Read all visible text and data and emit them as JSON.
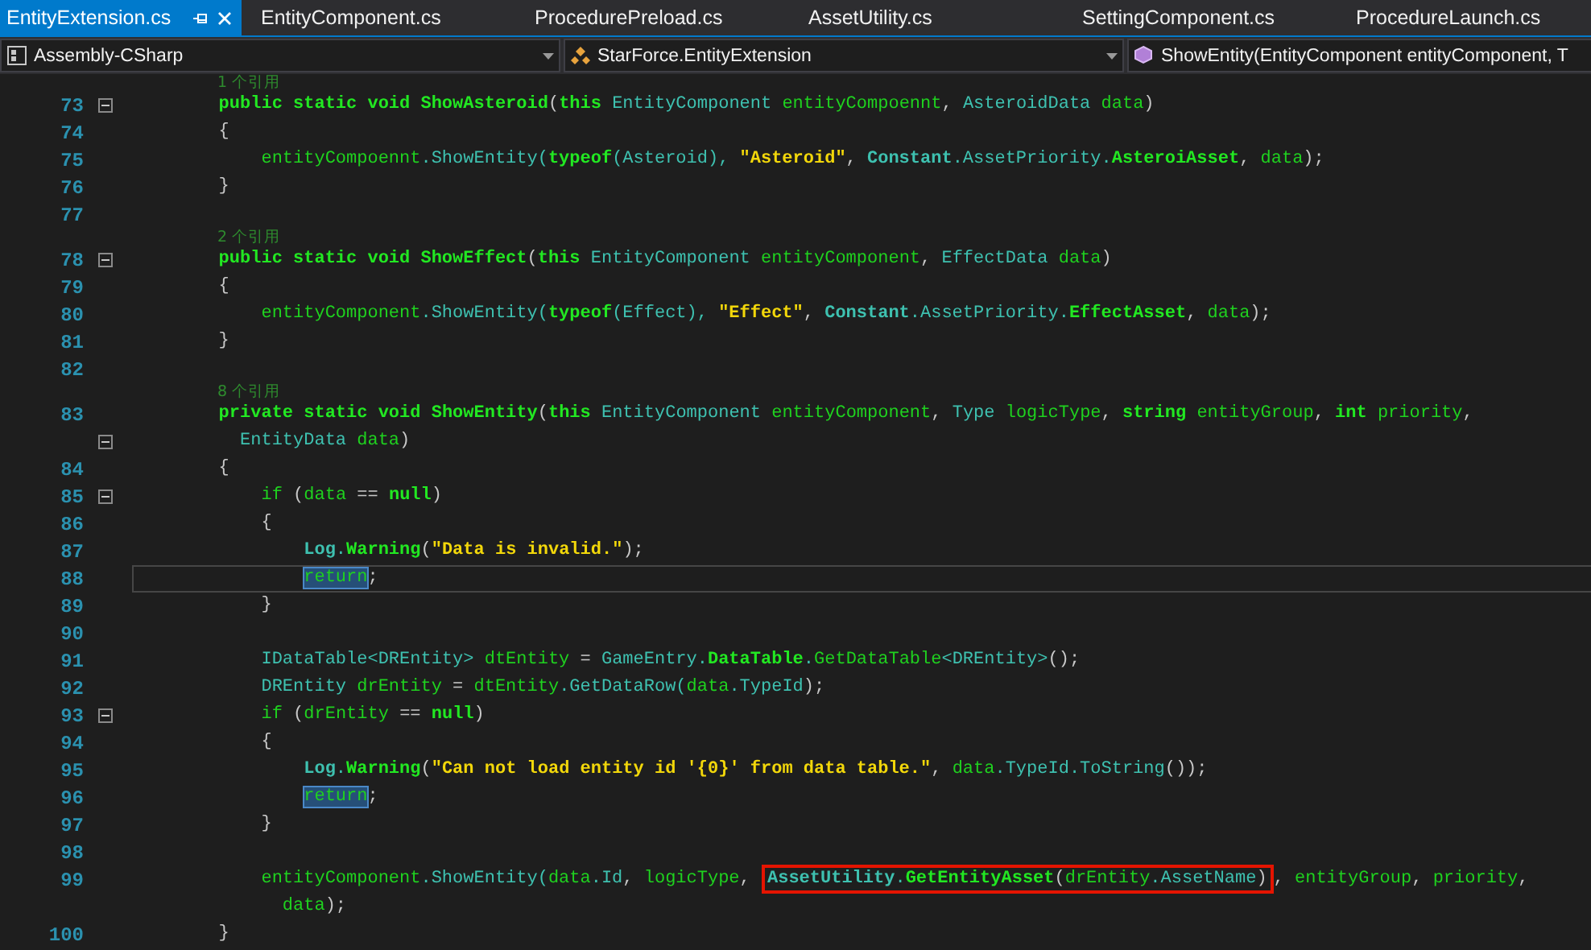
{
  "tabs": [
    {
      "label": "EntityExtension.cs",
      "selected": true
    },
    {
      "label": "EntityComponent.cs",
      "selected": false
    },
    {
      "label": "ProcedurePreload.cs",
      "selected": false
    },
    {
      "label": "AssetUtility.cs",
      "selected": false
    },
    {
      "label": "SettingComponent.cs",
      "selected": false
    },
    {
      "label": "ProcedureLaunch.cs",
      "selected": false
    }
  ],
  "navigation_bar": [
    {
      "kind": "project",
      "text": "Assembly-CSharp"
    },
    {
      "kind": "class",
      "text": "StarForce.EntityExtension"
    },
    {
      "kind": "member",
      "text": "ShowEntity(EntityComponent entityComponent, T"
    }
  ],
  "lines": [
    {
      "references": "1 个引用",
      "number": "73",
      "fold": true,
      "tokens": [
        {
          "kind": "keyword",
          "text": "        public static void "
        },
        {
          "kind": "method",
          "text": "ShowAsteroid"
        },
        {
          "kind": "punct",
          "text": "("
        },
        {
          "kind": "keyword",
          "text": "this "
        },
        {
          "kind": "type",
          "text": "EntityComponent "
        },
        {
          "kind": "name",
          "text": "entityCompoennt"
        },
        {
          "kind": "punct",
          "text": ", "
        },
        {
          "kind": "type",
          "text": "AsteroidData "
        },
        {
          "kind": "name",
          "text": "data"
        },
        {
          "kind": "punct",
          "text": ")"
        }
      ]
    },
    {
      "number": "74",
      "tokens": [
        {
          "kind": "punct",
          "text": "        {"
        }
      ]
    },
    {
      "number": "75",
      "tokens": [
        {
          "kind": "name",
          "text": "            entityCompoennt"
        },
        {
          "kind": "type",
          "text": ".ShowEntity("
        },
        {
          "kind": "keyword",
          "text": "typeof"
        },
        {
          "kind": "type",
          "text": "(Asteroid), "
        },
        {
          "kind": "string",
          "text": "\"Asteroid\""
        },
        {
          "kind": "punct",
          "text": ", "
        },
        {
          "kind": "typebold",
          "text": "Constant"
        },
        {
          "kind": "type",
          "text": ".AssetPriority."
        },
        {
          "kind": "method",
          "text": "AsteroiAsset"
        },
        {
          "kind": "punct",
          "text": ", "
        },
        {
          "kind": "name",
          "text": "data"
        },
        {
          "kind": "punct",
          "text": ");"
        }
      ]
    },
    {
      "number": "76",
      "tokens": [
        {
          "kind": "punct",
          "text": "        }"
        }
      ]
    },
    {
      "number": "77"
    },
    {
      "references": "2 个引用",
      "number": "78",
      "fold": true,
      "tokens": [
        {
          "kind": "keyword",
          "text": "        public static void "
        },
        {
          "kind": "method",
          "text": "ShowEffect"
        },
        {
          "kind": "punct",
          "text": "("
        },
        {
          "kind": "keyword",
          "text": "this "
        },
        {
          "kind": "type",
          "text": "EntityComponent "
        },
        {
          "kind": "name",
          "text": "entityComponent"
        },
        {
          "kind": "punct",
          "text": ", "
        },
        {
          "kind": "type",
          "text": "EffectData "
        },
        {
          "kind": "name",
          "text": "data"
        },
        {
          "kind": "punct",
          "text": ")"
        }
      ]
    },
    {
      "number": "79",
      "tokens": [
        {
          "kind": "punct",
          "text": "        {"
        }
      ]
    },
    {
      "number": "80",
      "tokens": [
        {
          "kind": "name",
          "text": "            entityComponent"
        },
        {
          "kind": "type",
          "text": ".ShowEntity("
        },
        {
          "kind": "keyword",
          "text": "typeof"
        },
        {
          "kind": "type",
          "text": "(Effect), "
        },
        {
          "kind": "string",
          "text": "\"Effect\""
        },
        {
          "kind": "punct",
          "text": ", "
        },
        {
          "kind": "typebold",
          "text": "Constant"
        },
        {
          "kind": "type",
          "text": ".AssetPriority."
        },
        {
          "kind": "method",
          "text": "EffectAsset"
        },
        {
          "kind": "punct",
          "text": ", "
        },
        {
          "kind": "name",
          "text": "data"
        },
        {
          "kind": "punct",
          "text": ");"
        }
      ]
    },
    {
      "number": "81",
      "tokens": [
        {
          "kind": "punct",
          "text": "        }"
        }
      ]
    },
    {
      "number": "82"
    },
    {
      "references": "8 个引用",
      "number": "83",
      "tokens": [
        {
          "kind": "keyword",
          "text": "        private static void "
        },
        {
          "kind": "method",
          "text": "ShowEntity"
        },
        {
          "kind": "punct",
          "text": "("
        },
        {
          "kind": "keyword",
          "text": "this "
        },
        {
          "kind": "type",
          "text": "EntityComponent "
        },
        {
          "kind": "name",
          "text": "entityComponent"
        },
        {
          "kind": "punct",
          "text": ", "
        },
        {
          "kind": "type",
          "text": "Type "
        },
        {
          "kind": "name",
          "text": "logicType"
        },
        {
          "kind": "punct",
          "text": ", "
        },
        {
          "kind": "keyword",
          "text": "string "
        },
        {
          "kind": "name",
          "text": "entityGroup"
        },
        {
          "kind": "punct",
          "text": ", "
        },
        {
          "kind": "keyword",
          "text": "int "
        },
        {
          "kind": "name",
          "text": "priority"
        },
        {
          "kind": "punct",
          "text": ","
        }
      ]
    },
    {
      "fold": true,
      "tokens": [
        {
          "kind": "type",
          "text": "          EntityData "
        },
        {
          "kind": "name",
          "text": "data"
        },
        {
          "kind": "punct",
          "text": ")"
        }
      ]
    },
    {
      "number": "84",
      "tokens": [
        {
          "kind": "punct",
          "text": "        {"
        }
      ]
    },
    {
      "number": "85",
      "fold": true,
      "tokens": [
        {
          "kind": "name",
          "text": "            if "
        },
        {
          "kind": "punct",
          "text": "("
        },
        {
          "kind": "name",
          "text": "data "
        },
        {
          "kind": "punct",
          "text": "== "
        },
        {
          "kind": "keyword",
          "text": "null"
        },
        {
          "kind": "punct",
          "text": ")"
        }
      ]
    },
    {
      "number": "86",
      "tokens": [
        {
          "kind": "punct",
          "text": "            {"
        }
      ]
    },
    {
      "number": "87",
      "tokens": [
        {
          "kind": "typebold",
          "text": "                Log"
        },
        {
          "kind": "type",
          "text": "."
        },
        {
          "kind": "method",
          "text": "Warning"
        },
        {
          "kind": "punct",
          "text": "("
        },
        {
          "kind": "string",
          "text": "\"Data is invalid.\""
        },
        {
          "kind": "punct",
          "text": ");"
        }
      ]
    },
    {
      "number": "88",
      "current": true,
      "tokens": [
        {
          "kind": "name",
          "text": "                return",
          "highlighted": true
        },
        {
          "kind": "punct",
          "text": ";"
        }
      ]
    },
    {
      "number": "89",
      "tokens": [
        {
          "kind": "punct",
          "text": "            }"
        }
      ]
    },
    {
      "number": "90"
    },
    {
      "number": "91",
      "tokens": [
        {
          "kind": "type",
          "text": "            IDataTable<DREntity> "
        },
        {
          "kind": "name",
          "text": "dtEntity "
        },
        {
          "kind": "punct",
          "text": "= "
        },
        {
          "kind": "type",
          "text": "GameEntry."
        },
        {
          "kind": "method",
          "text": "DataTable"
        },
        {
          "kind": "type",
          "text": "."
        },
        {
          "kind": "name",
          "text": "GetDataTable"
        },
        {
          "kind": "type",
          "text": "<DREntity>"
        },
        {
          "kind": "punct",
          "text": "();"
        }
      ]
    },
    {
      "number": "92",
      "tokens": [
        {
          "kind": "type",
          "text": "            DREntity "
        },
        {
          "kind": "name",
          "text": "drEntity "
        },
        {
          "kind": "punct",
          "text": "= "
        },
        {
          "kind": "name",
          "text": "dtEntity"
        },
        {
          "kind": "type",
          "text": ".GetDataRow("
        },
        {
          "kind": "name",
          "text": "data"
        },
        {
          "kind": "type",
          "text": ".TypeId"
        },
        {
          "kind": "punct",
          "text": ");"
        }
      ]
    },
    {
      "number": "93",
      "fold": true,
      "tokens": [
        {
          "kind": "name",
          "text": "            if "
        },
        {
          "kind": "punct",
          "text": "("
        },
        {
          "kind": "name",
          "text": "drEntity "
        },
        {
          "kind": "punct",
          "text": "== "
        },
        {
          "kind": "keyword",
          "text": "null"
        },
        {
          "kind": "punct",
          "text": ")"
        }
      ]
    },
    {
      "number": "94",
      "tokens": [
        {
          "kind": "punct",
          "text": "            {"
        }
      ]
    },
    {
      "number": "95",
      "tokens": [
        {
          "kind": "typebold",
          "text": "                Log"
        },
        {
          "kind": "type",
          "text": "."
        },
        {
          "kind": "method",
          "text": "Warning"
        },
        {
          "kind": "punct",
          "text": "("
        },
        {
          "kind": "string",
          "text": "\"Can not load entity id '{0}' from data table.\""
        },
        {
          "kind": "punct",
          "text": ", "
        },
        {
          "kind": "name",
          "text": "data"
        },
        {
          "kind": "type",
          "text": ".TypeId.ToString"
        },
        {
          "kind": "punct",
          "text": "());"
        }
      ]
    },
    {
      "number": "96",
      "tokens": [
        {
          "kind": "name",
          "text": "                return",
          "highlighted": true
        },
        {
          "kind": "punct",
          "text": ";"
        }
      ]
    },
    {
      "number": "97",
      "tokens": [
        {
          "kind": "punct",
          "text": "            }"
        }
      ]
    },
    {
      "number": "98"
    },
    {
      "number": "99",
      "tokens": [
        {
          "kind": "name",
          "text": "            entityComponent"
        },
        {
          "kind": "type",
          "text": ".ShowEntity("
        },
        {
          "kind": "name",
          "text": "data"
        },
        {
          "kind": "type",
          "text": ".Id"
        },
        {
          "kind": "punct",
          "text": ", "
        },
        {
          "kind": "name",
          "text": "logicType"
        },
        {
          "kind": "punct",
          "text": ", "
        },
        {
          "kind": "box",
          "tokens": [
            {
              "kind": "typebold",
              "text": "AssetUtility"
            },
            {
              "kind": "type",
              "text": "."
            },
            {
              "kind": "method",
              "text": "GetEntityAsset"
            },
            {
              "kind": "punct",
              "text": "("
            },
            {
              "kind": "name",
              "text": "drEntity"
            },
            {
              "kind": "type",
              "text": ".AssetName"
            },
            {
              "kind": "punct",
              "text": ")"
            }
          ]
        },
        {
          "kind": "punct",
          "text": ", "
        },
        {
          "kind": "name",
          "text": "entityGroup"
        },
        {
          "kind": "punct",
          "text": ", "
        },
        {
          "kind": "name",
          "text": "priority"
        },
        {
          "kind": "punct",
          "text": ","
        }
      ]
    },
    {
      "tokens": [
        {
          "kind": "name",
          "text": "              data"
        },
        {
          "kind": "punct",
          "text": ");"
        }
      ]
    },
    {
      "number": "100",
      "tokens": [
        {
          "kind": "punct",
          "text": "        }"
        }
      ]
    }
  ]
}
